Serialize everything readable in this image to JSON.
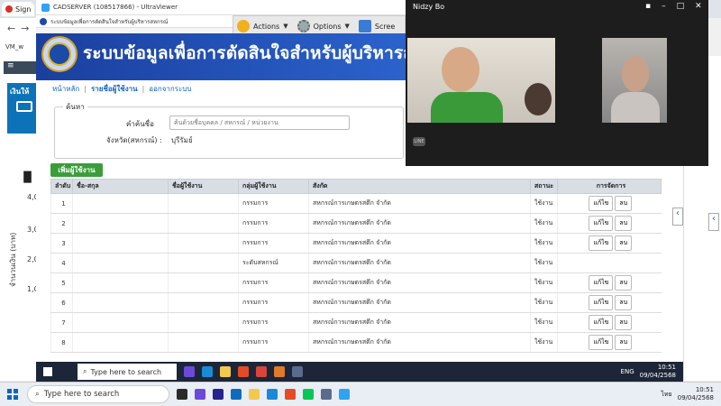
{
  "outer_browser": {
    "tab_label": "Sign",
    "bookmark": "VM_w"
  },
  "uv": {
    "title": "CADSERVER (108517866) - UltraViewer"
  },
  "remote_tab": {
    "label": "ระบบข้อมูลเพื่อการตัดสินใจสำหรับผู้บริหารสหกรณ์"
  },
  "toolbar": {
    "actions": "Actions",
    "options": "Options",
    "screen": "Scree"
  },
  "site": {
    "title": "ระบบข้อมูลเพื่อการตัดสินใจสำหรับผู้บริหารสหกรณ์"
  },
  "breadcrumb": [
    "หน้าหลัก",
    "รายชื่อผู้ใช้งาน",
    "ออกจากระบบ"
  ],
  "search": {
    "legend": "ค้นหา",
    "keyword_label": "คำค้นชื่อ",
    "keyword_placeholder": "ค้นด้วยชื่อบุคคล / สหกรณ์ / หน่วยงาน",
    "province_label": "จังหวัด(สหกรณ์) :",
    "province_value": "บุรีรัมย์"
  },
  "add_user_label": "เพิ่มผู้ใช้งาน",
  "table": {
    "headers": [
      "ลำดับ",
      "ชื่อ-สกุล",
      "ชื่อผู้ใช้งาน",
      "กลุ่มผู้ใช้งาน",
      "สังกัด",
      "สถานะ",
      "การจัดการ"
    ],
    "edit_label": "แก้ไข",
    "delete_label": "ลบ",
    "rows": [
      {
        "no": "1",
        "group": "กรรมการ",
        "org": "สหกรณ์การเกษตรสตึก จำกัด",
        "status": "ใช้งาน",
        "actions": true
      },
      {
        "no": "2",
        "group": "กรรมการ",
        "org": "สหกรณ์การเกษตรสตึก จำกัด",
        "status": "ใช้งาน",
        "actions": true
      },
      {
        "no": "3",
        "group": "กรรมการ",
        "org": "สหกรณ์การเกษตรสตึก จำกัด",
        "status": "ใช้งาน",
        "actions": true
      },
      {
        "no": "4",
        "group": "ระดับสหกรณ์",
        "org": "สหกรณ์การเกษตรสตึก จำกัด",
        "status": "ใช้งาน",
        "actions": false
      },
      {
        "no": "5",
        "group": "กรรมการ",
        "org": "สหกรณ์การเกษตรสตึก จำกัด",
        "status": "ใช้งาน",
        "actions": true
      },
      {
        "no": "6",
        "group": "กรรมการ",
        "org": "สหกรณ์การเกษตรสตึก จำกัด",
        "status": "ใช้งาน",
        "actions": true
      },
      {
        "no": "7",
        "group": "กรรมการ",
        "org": "สหกรณ์การเกษตรสตึก จำกัด",
        "status": "ใช้งาน",
        "actions": true
      },
      {
        "no": "8",
        "group": "กรรมการ",
        "org": "สหกรณ์การเกษตรสตึก จำกัด",
        "status": "ใช้งาน",
        "actions": true
      }
    ]
  },
  "background_app": {
    "card_title": "เงินให้",
    "ticks": [
      "4,0",
      "3,0",
      "2,0",
      "1,0"
    ],
    "ylabel": "จำนวนเงิน (บาท)"
  },
  "call": {
    "title": "Nidzy Bo"
  },
  "inner_taskbar": {
    "search_text": "Type here to search",
    "lang": "ENG",
    "time": "10:51",
    "date": "09/04/2568"
  },
  "outer_taskbar": {
    "search_text": "Type here to search",
    "lang": "ไทย",
    "time": "10:51",
    "date": "09/04/2568"
  },
  "colors": {
    "header_blue": "#1a3f9e",
    "add_green": "#3a9d3a",
    "link_blue": "#1565c0"
  }
}
